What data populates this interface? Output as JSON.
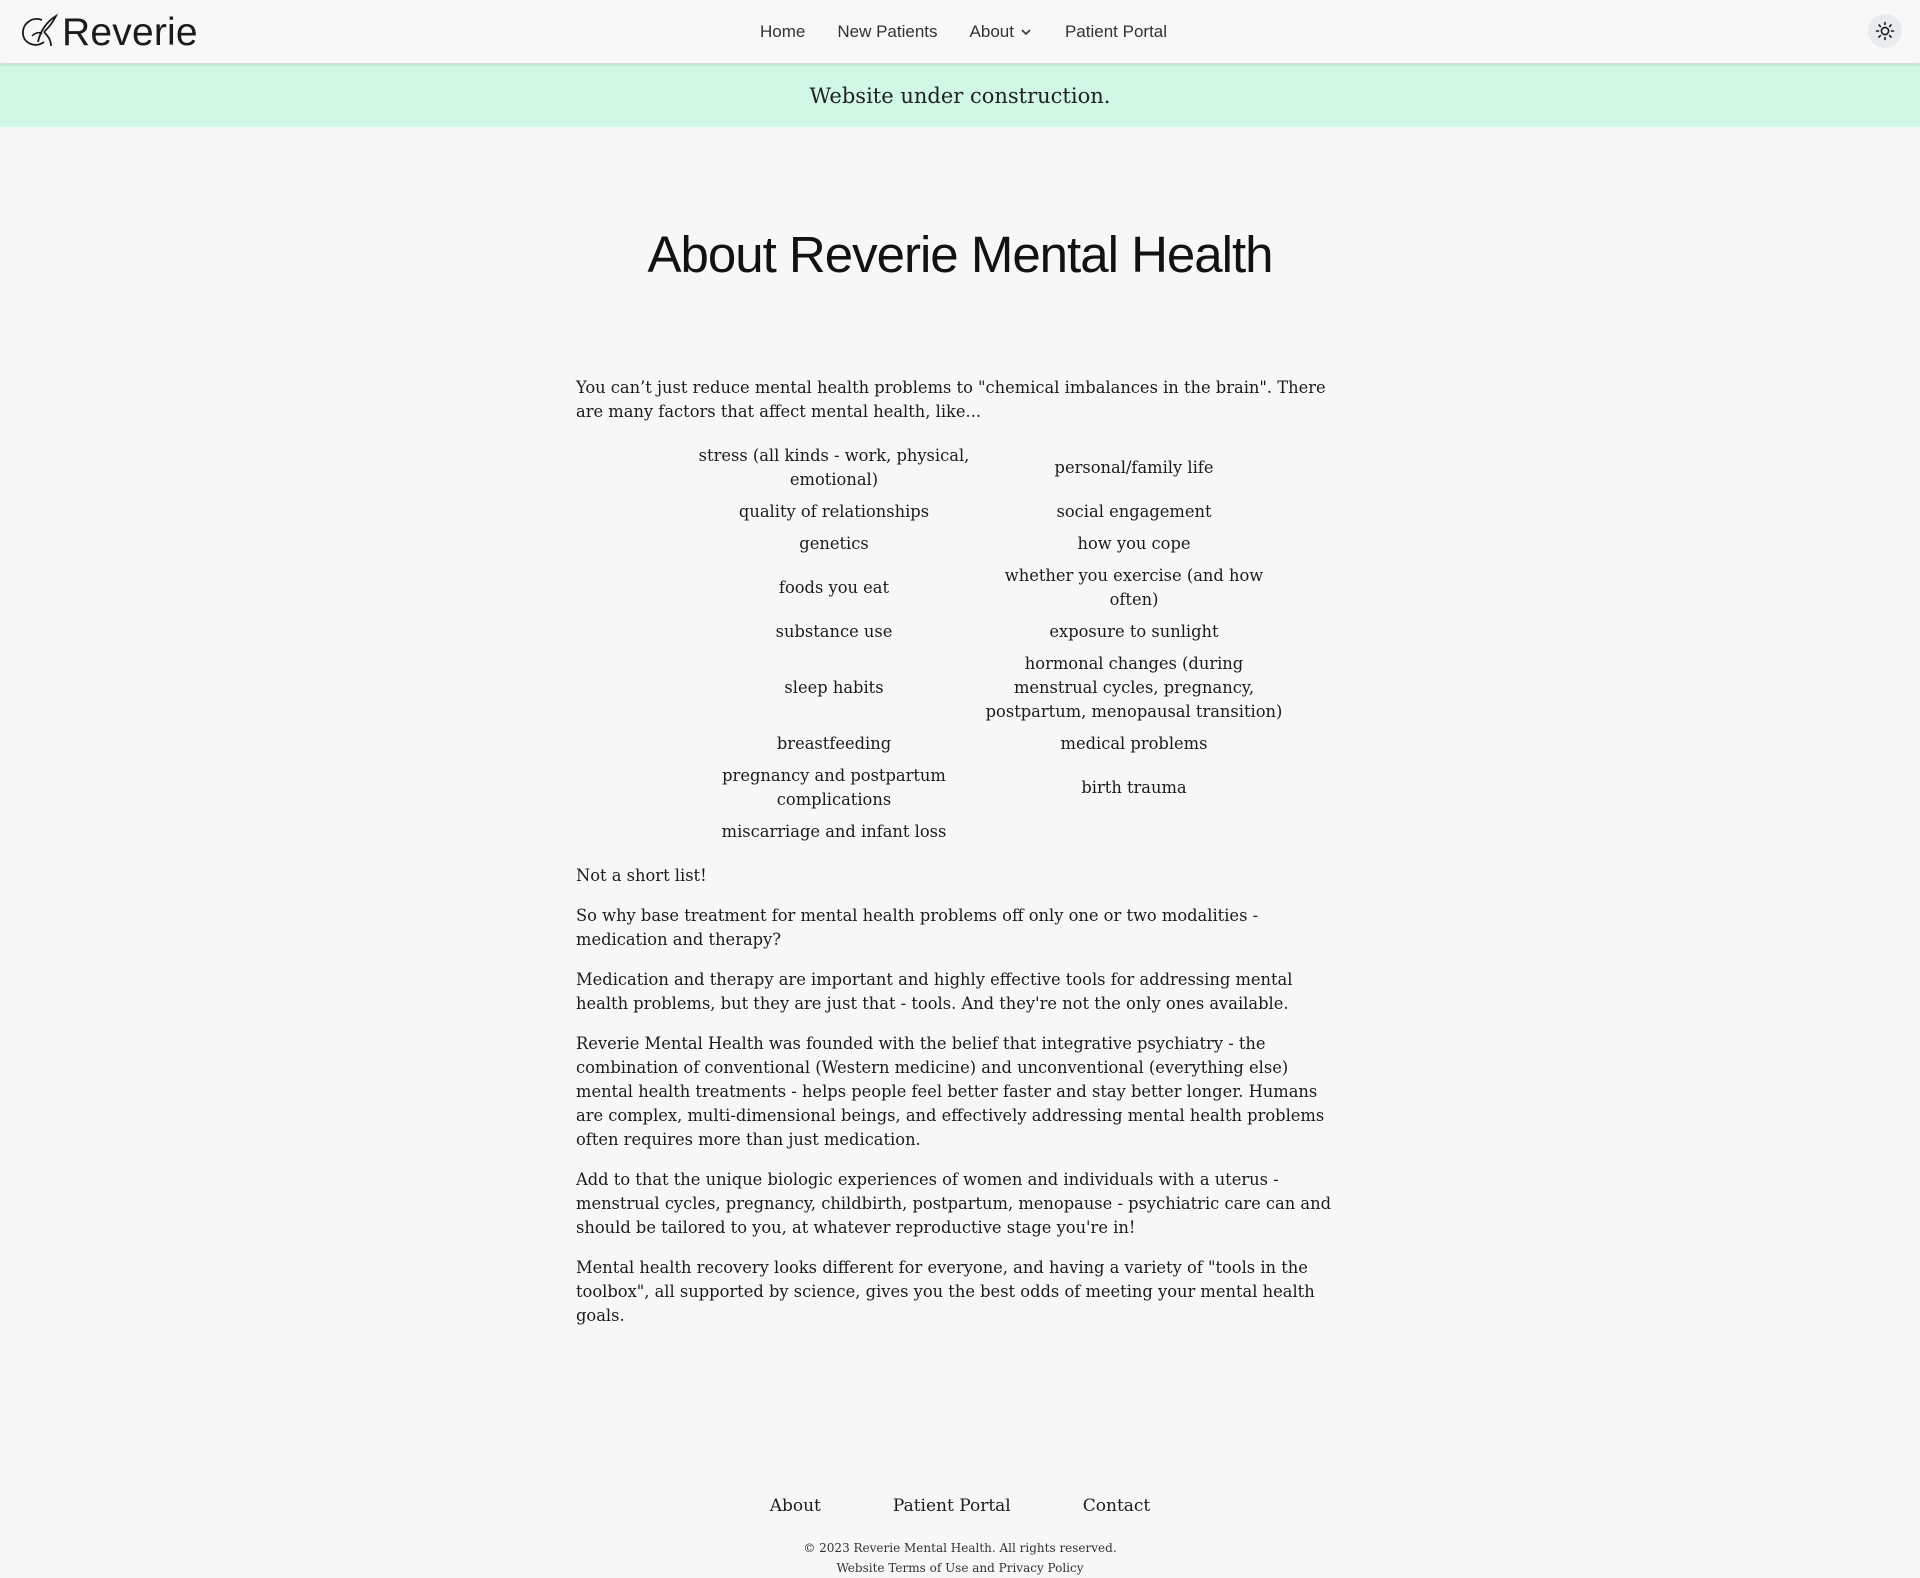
{
  "brand": {
    "name": "Reverie"
  },
  "nav": {
    "home": "Home",
    "new_patients": "New Patients",
    "about": "About",
    "patient_portal": "Patient Portal"
  },
  "banner": {
    "text": "Website under construction."
  },
  "page": {
    "title": "About Reverie Mental Health",
    "intro": "You can’t just reduce mental health problems to \"chemical imbalances in the brain\". There are many factors that affect mental health, like...",
    "factors": [
      [
        "stress (all kinds - work, physical, emotional)",
        "personal/family life"
      ],
      [
        "quality of relationships",
        "social engagement"
      ],
      [
        "genetics",
        "how you cope"
      ],
      [
        "foods you eat",
        "whether you exercise (and how often)"
      ],
      [
        "substance use",
        "exposure to sunlight"
      ],
      [
        "sleep habits",
        "hormonal changes (during menstrual cycles, pregnancy, postpartum, menopausal transition)"
      ],
      [
        "breastfeeding",
        "medical problems"
      ],
      [
        "pregnancy and postpartum complications",
        "birth trauma"
      ],
      [
        "miscarriage and infant loss",
        ""
      ]
    ],
    "paragraphs": [
      "Not a short list!",
      "So why base treatment for mental health problems off only one or two modalities - medication and therapy?",
      "Medication and therapy are important and highly effective tools for addressing mental health problems, but they are just that - tools. And they're not the only ones available.",
      "Reverie Mental Health was founded with the belief that integrative psychiatry - the combination of conventional (Western medicine) and unconventional (everything else) mental health treatments - helps people feel better faster and stay better longer. Humans are complex, multi-dimensional beings, and effectively addressing mental health problems often requires more than just medication.",
      "Add to that the unique biologic experiences of women and individuals with a uterus - menstrual cycles, pregnancy, childbirth, postpartum, menopause - psychiatric care can and should be tailored to you, at whatever reproductive stage you're in!",
      "Mental health recovery looks different for everyone, and having a variety of \"tools in the toolbox\", all supported by science, gives you the best odds of meeting your mental health goals."
    ]
  },
  "footer": {
    "about": "About",
    "patient_portal": "Patient Portal",
    "contact": "Contact",
    "copyright": "© 2023 Reverie Mental Health. All rights reserved.",
    "terms": "Website Terms of Use and Privacy Policy"
  },
  "icons": {
    "theme": "sun-icon",
    "about_dropdown": "chevron-down-icon",
    "logo": "reverie-logo-icon"
  },
  "colors": {
    "banner_bg": "#d1f8e4",
    "page_bg": "#f7f7f7",
    "text": "#1b1b1b"
  }
}
